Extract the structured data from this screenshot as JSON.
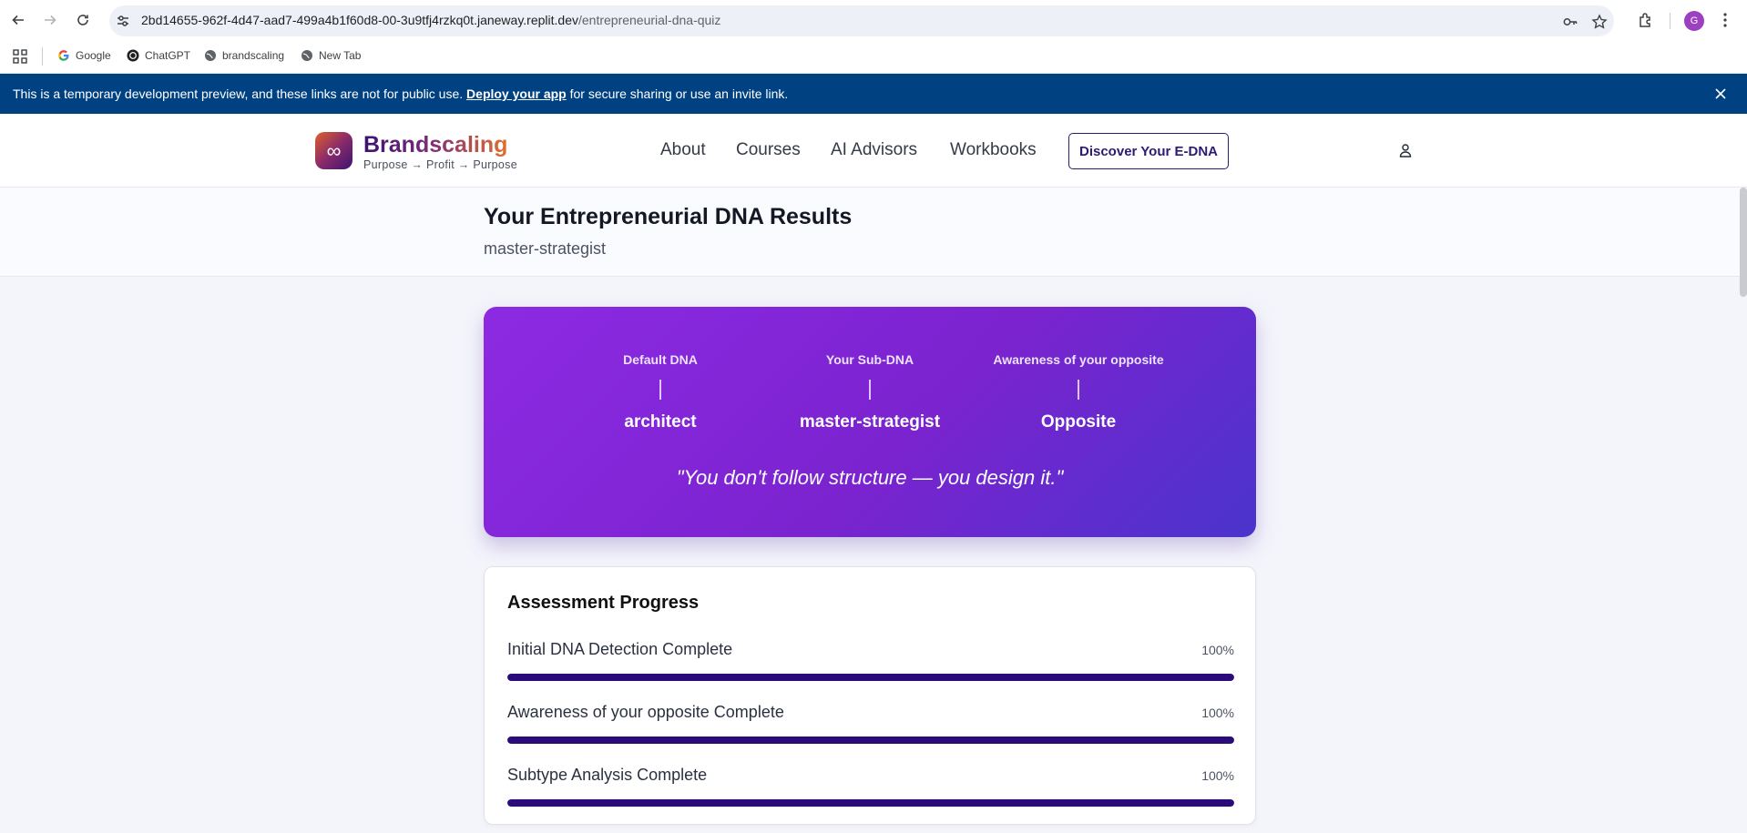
{
  "browser": {
    "url_host": "2bd14655-962f-4d47-aad7-499a4b1f60d8-00-3u9tfj4rzkq0t.janeway.replit.dev",
    "url_path": "/entrepreneurial-dna-quiz",
    "profile_initial": "G",
    "bookmarks": [
      {
        "label": "Google",
        "icon": "google-icon"
      },
      {
        "label": "ChatGPT",
        "icon": "chatgpt-icon"
      },
      {
        "label": "brandscaling",
        "icon": "globe-icon"
      },
      {
        "label": "New Tab",
        "icon": "globe-icon"
      }
    ]
  },
  "banner": {
    "text_before": "This is a temporary development preview, and these links are not for public use. ",
    "link": "Deploy your app",
    "text_after": " for secure sharing or use an invite link."
  },
  "header": {
    "logo_symbol": "∞",
    "brand": "Brandscaling",
    "tagline": "Purpose → Profit → Purpose",
    "nav": [
      "About",
      "Courses",
      "AI Advisors",
      "Workbooks"
    ],
    "cta": "Discover Your E-DNA"
  },
  "page": {
    "title": "Your Entrepreneurial DNA Results",
    "subtitle": "master-strategist"
  },
  "dna": {
    "columns": [
      {
        "label": "Default DNA",
        "value": "architect"
      },
      {
        "label": "Your Sub-DNA",
        "value": "master-strategist"
      },
      {
        "label": "Awareness of your opposite",
        "value": "Opposite"
      }
    ],
    "quote": "\"You don't follow structure — you design it.\"",
    "colors": {
      "gradient_start": "#8d2ae3",
      "gradient_end": "#4a34cc"
    }
  },
  "progress": {
    "title": "Assessment Progress",
    "items": [
      {
        "label": "Initial DNA Detection Complete",
        "percent_text": "100%",
        "percent": 100
      },
      {
        "label": "Awareness of your opposite Complete",
        "percent_text": "100%",
        "percent": 100
      },
      {
        "label": "Subtype Analysis Complete",
        "percent_text": "100%",
        "percent": 100
      }
    ],
    "bar_color": "#2b0b7a"
  }
}
